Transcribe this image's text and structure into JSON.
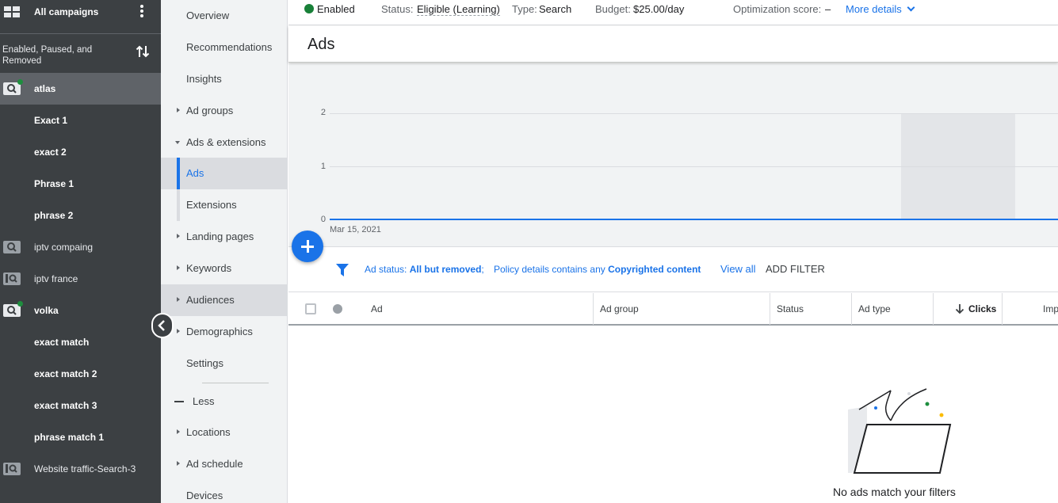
{
  "left_nav": {
    "header_title": "All campaigns",
    "filter_label": "Enabled, Paused, and Removed",
    "items": [
      {
        "label": "atlas",
        "type": "campaign",
        "active": true
      },
      {
        "label": "Exact 1",
        "type": "adgroup"
      },
      {
        "label": "exact 2",
        "type": "adgroup"
      },
      {
        "label": "Phrase 1",
        "type": "adgroup"
      },
      {
        "label": "phrase 2",
        "type": "adgroup"
      },
      {
        "label": "iptv compaing",
        "type": "campaign"
      },
      {
        "label": "iptv france",
        "type": "campaign"
      },
      {
        "label": "volka",
        "type": "campaign"
      },
      {
        "label": "exact match",
        "type": "adgroup"
      },
      {
        "label": "exact match 2",
        "type": "adgroup"
      },
      {
        "label": "exact match 3",
        "type": "adgroup"
      },
      {
        "label": "phrase match 1",
        "type": "adgroup"
      },
      {
        "label": "Website traffic-Search-3",
        "type": "campaign"
      }
    ]
  },
  "sub_nav": {
    "items": [
      {
        "label": "Overview"
      },
      {
        "label": "Recommendations"
      },
      {
        "label": "Insights"
      },
      {
        "label": "Ad groups"
      },
      {
        "label": "Ads & extensions"
      },
      {
        "label": "Ads"
      },
      {
        "label": "Extensions"
      },
      {
        "label": "Landing pages"
      },
      {
        "label": "Keywords"
      },
      {
        "label": "Audiences"
      },
      {
        "label": "Demographics"
      },
      {
        "label": "Settings"
      },
      {
        "label": "Less"
      },
      {
        "label": "Locations"
      },
      {
        "label": "Ad schedule"
      },
      {
        "label": "Devices"
      }
    ]
  },
  "top_bar": {
    "status_enabled": "Enabled",
    "status_prefix": "Status:",
    "status_value": "Eligible (Learning)",
    "type_prefix": "Type:",
    "type_value": "Search",
    "budget_prefix": "Budget:",
    "budget_value": "$25.00/day",
    "opt_prefix": "Optimization score:",
    "opt_value": "–",
    "more_details": "More details"
  },
  "page_title": "Ads",
  "chart_data": {
    "type": "line",
    "x": [
      "Mar 15, 2021"
    ],
    "series": [
      {
        "values": [
          0
        ]
      }
    ],
    "yticks": [
      "2",
      "1",
      "0"
    ],
    "ylim": [
      0,
      2
    ],
    "grid": true
  },
  "filter_bar": {
    "f1_prefix": "Ad status:",
    "f1_value": "All but removed",
    "f1_sep": ";",
    "f2_prefix": "Policy details contains any",
    "f2_value": "Copyrighted content",
    "view_all": "View all",
    "add_filter": "ADD FILTER"
  },
  "table": {
    "columns": [
      "Ad",
      "Ad group",
      "Status",
      "Ad type",
      "Clicks",
      "Imp"
    ],
    "empty_message": "No ads match your filters"
  },
  "colors": {
    "accent": "#1a73e8",
    "enabled_green": "#188038",
    "nav_dark": "#3c4043"
  }
}
